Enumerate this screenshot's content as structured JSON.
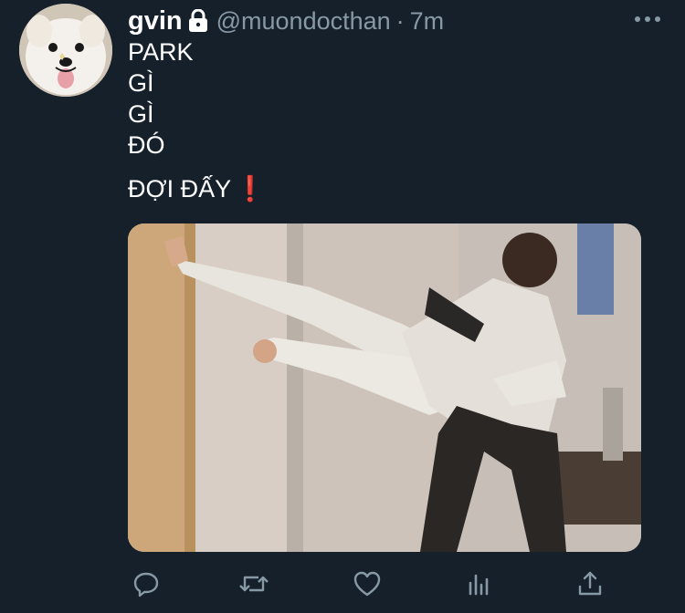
{
  "tweet": {
    "author": {
      "display_name": "gvin",
      "protected": true,
      "handle": "@muondocthan",
      "avatar_icon": "dog-avatar"
    },
    "separator": "·",
    "timestamp": "7m",
    "text_lines": [
      "PARK",
      "GÌ",
      "GÌ",
      "ĐÓ"
    ],
    "final_line": "ĐỢI ĐẤY",
    "final_emoji": "❗",
    "media_description": "photo-two-men-fighting-kick",
    "actions": [
      {
        "name": "reply-icon"
      },
      {
        "name": "retweet-icon"
      },
      {
        "name": "like-icon"
      },
      {
        "name": "analytics-icon"
      },
      {
        "name": "share-icon"
      }
    ]
  },
  "colors": {
    "background": "#15202b",
    "primary_text": "#ffffff",
    "secondary_text": "#8899a6",
    "accent_red": "#e0245e"
  }
}
